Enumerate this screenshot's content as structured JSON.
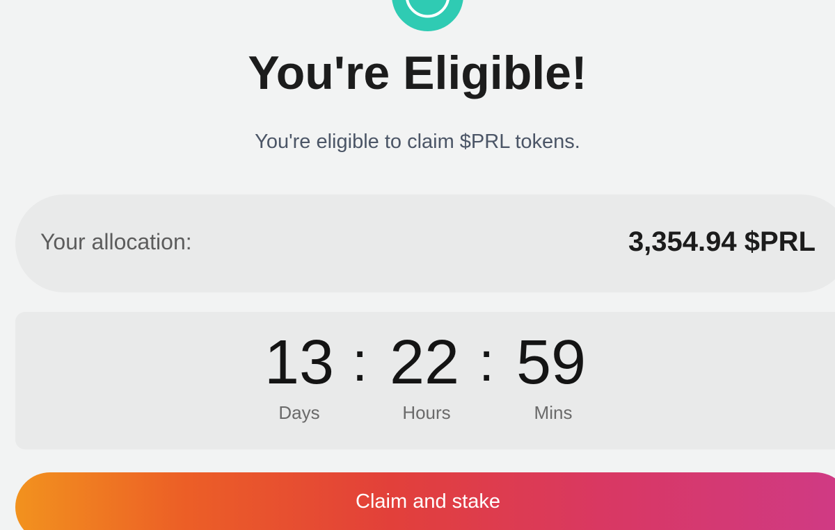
{
  "header": {
    "badge_icon": "check-circle-icon",
    "badge_color": "#2fcbb3",
    "title": "You're Eligible!",
    "subtitle": "You're eligible to claim $PRL tokens."
  },
  "allocation": {
    "label": "Your allocation:",
    "value": "3,354.94 $PRL"
  },
  "countdown": {
    "days": "13",
    "hours": "22",
    "mins": "59",
    "separator": ":",
    "days_label": "Days",
    "hours_label": "Hours",
    "mins_label": "Mins"
  },
  "action": {
    "claim_label": "Claim and stake",
    "gradient_colors": [
      "#f2921e",
      "#e2403a",
      "#cf3a86"
    ]
  }
}
